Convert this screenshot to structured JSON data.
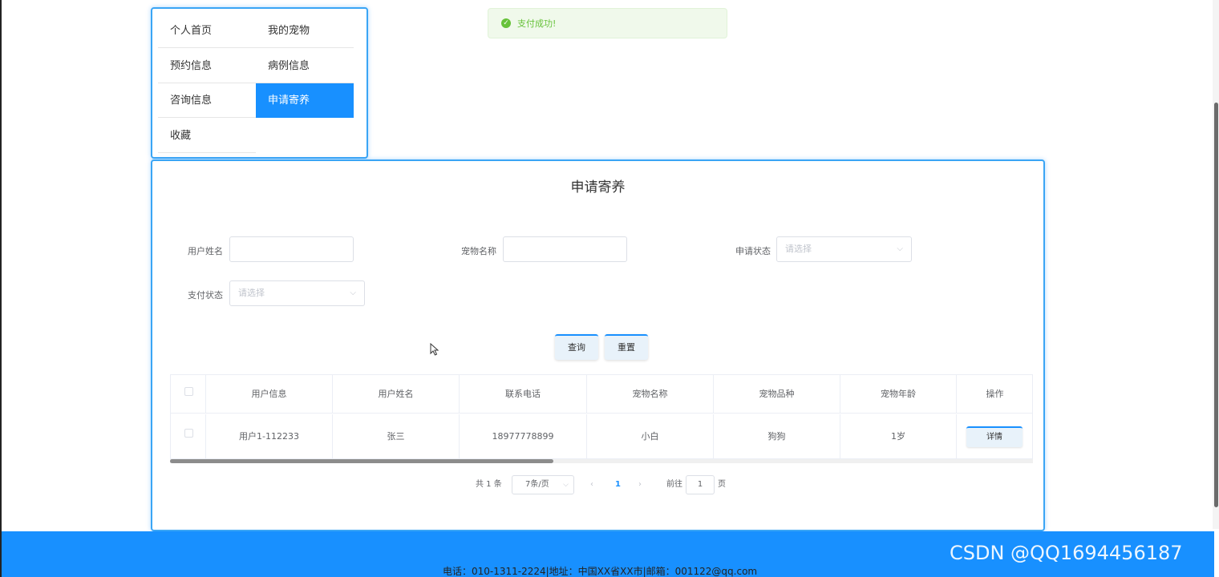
{
  "nav": {
    "items": [
      {
        "label": "个人首页",
        "active": false
      },
      {
        "label": "我的宠物",
        "active": false
      },
      {
        "label": "预约信息",
        "active": false
      },
      {
        "label": "病例信息",
        "active": false
      },
      {
        "label": "咨询信息",
        "active": false
      },
      {
        "label": "申请寄养",
        "active": true
      },
      {
        "label": "收藏",
        "active": false
      }
    ]
  },
  "toast": {
    "message": "支付成功!",
    "type": "success"
  },
  "panel": {
    "title": "申请寄养",
    "filters": {
      "user_name_label": "用户姓名",
      "user_name_value": "",
      "pet_name_label": "宠物名称",
      "pet_name_value": "",
      "apply_status_label": "申请状态",
      "apply_status_placeholder": "请选择",
      "pay_status_label": "支付状态",
      "pay_status_placeholder": "请选择"
    },
    "buttons": {
      "query": "查询",
      "reset": "重置"
    },
    "table": {
      "headers": [
        "用户信息",
        "用户姓名",
        "联系电话",
        "宠物名称",
        "宠物品种",
        "宠物年龄",
        "操作"
      ],
      "rows": [
        {
          "user_info": "用户1-112233",
          "user_name": "张三",
          "phone": "18977778899",
          "pet_name": "小白",
          "breed": "狗狗",
          "age": "1岁",
          "action": "详情"
        }
      ]
    },
    "pagination": {
      "total_text": "共 1 条",
      "page_size": "7条/页",
      "current_page": "1",
      "goto_label": "前往",
      "goto_value": "1",
      "page_unit": "页"
    }
  },
  "footer": {
    "text": "电话：010-1311-2224|地址：中国XX省XX市|邮箱：001122@qq.com"
  },
  "watermark": "CSDN @QQ1694456187",
  "colors": {
    "primary": "#1890ff",
    "success": "#67c23a"
  }
}
